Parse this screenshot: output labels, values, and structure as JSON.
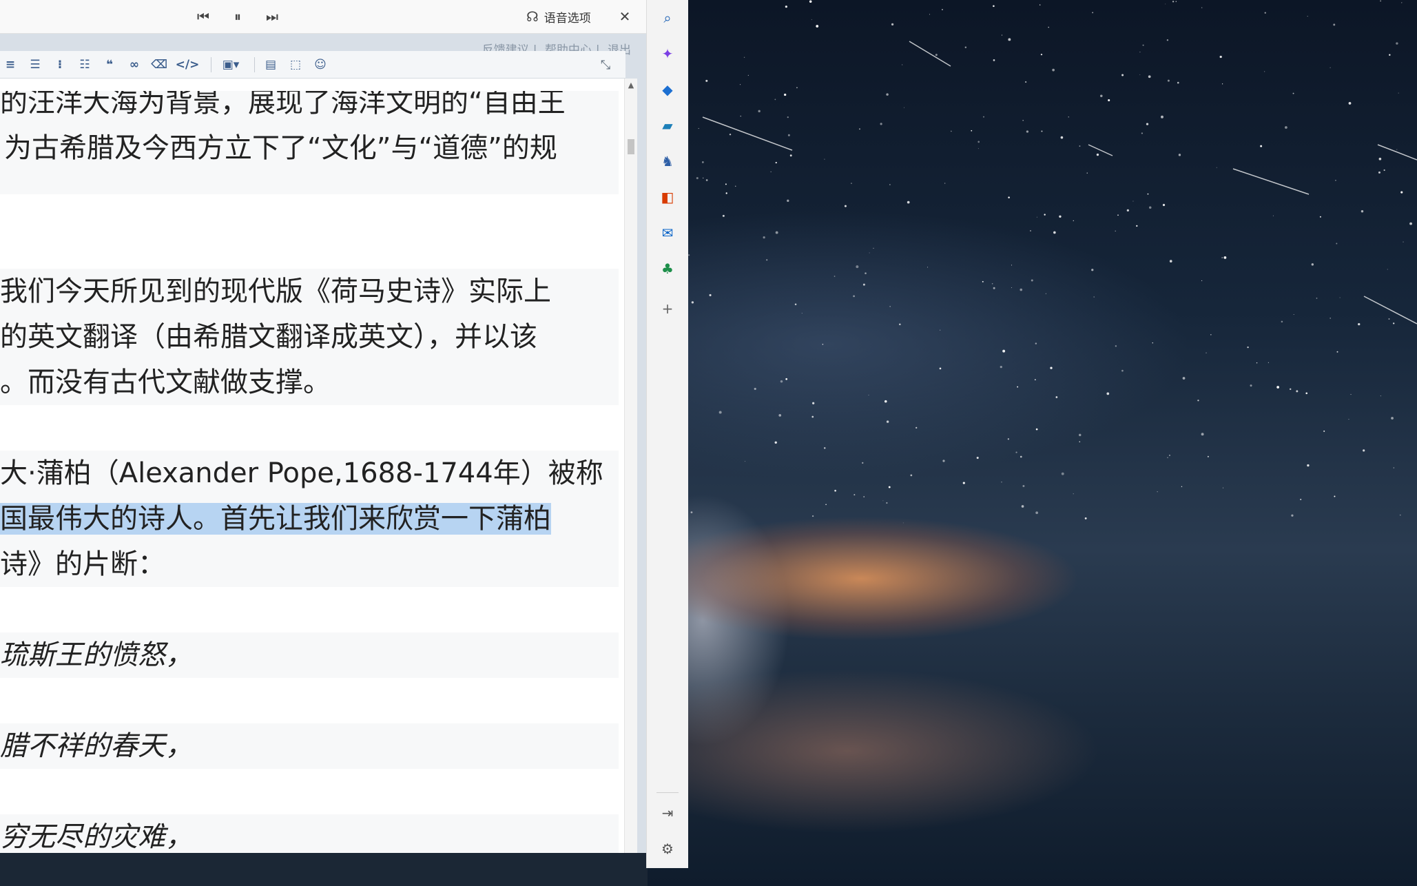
{
  "read_aloud": {
    "voice_options_label": "语音选项",
    "prev_icon": "previous-icon",
    "pause_icon": "pause-icon",
    "next_icon": "next-icon",
    "close_icon": "close-icon"
  },
  "editor": {
    "top_links": [
      "反馈建议",
      "帮助中心",
      "退出"
    ],
    "toolbar_icons": [
      "align-icon",
      "indent-icon",
      "list-icon",
      "ordered-list-icon",
      "quote-icon",
      "link-icon",
      "clear-format-icon",
      "code-icon",
      "image-icon",
      "page-icon",
      "select-icon",
      "emoji-icon"
    ],
    "paragraphs": [
      {
        "lines": [
          "的汪洋大海为背景，展现了海洋文明的“自由王",
          "为古希腊及今西方立下了“文化”与“道德”的规",
          ""
        ]
      },
      {
        "lines": [
          "我们今天所见到的现代版《荷马史诗》实际上",
          "的英文翻译（由希腊文翻译成英文），并以该",
          "。而没有古代文献做支撑。"
        ]
      },
      {
        "lines": [
          "大·蒲柏（Alexander Pope,1688-1744年）被称",
          "国最伟大的诗人。首先让我们来欣赏一下蒲柏",
          "诗》的片断："
        ]
      },
      {
        "lines": [
          "琉斯王的愤怒，"
        ]
      },
      {
        "lines": [
          "腊不祥的春天，"
        ]
      },
      {
        "lines": [
          "穷无尽的灾难，"
        ]
      }
    ]
  },
  "sidebar": {
    "icons": [
      "search-icon",
      "copilot-icon",
      "shopping-icon",
      "tools-icon",
      "games-icon",
      "office-icon",
      "outlook-icon",
      "tree-icon",
      "add-icon"
    ],
    "bottom_icons": [
      "hide-sidebar-icon",
      "settings-icon"
    ]
  },
  "colors": {
    "highlight": "#b7d4f2",
    "sidebar_bg": "#f3f3f3"
  }
}
